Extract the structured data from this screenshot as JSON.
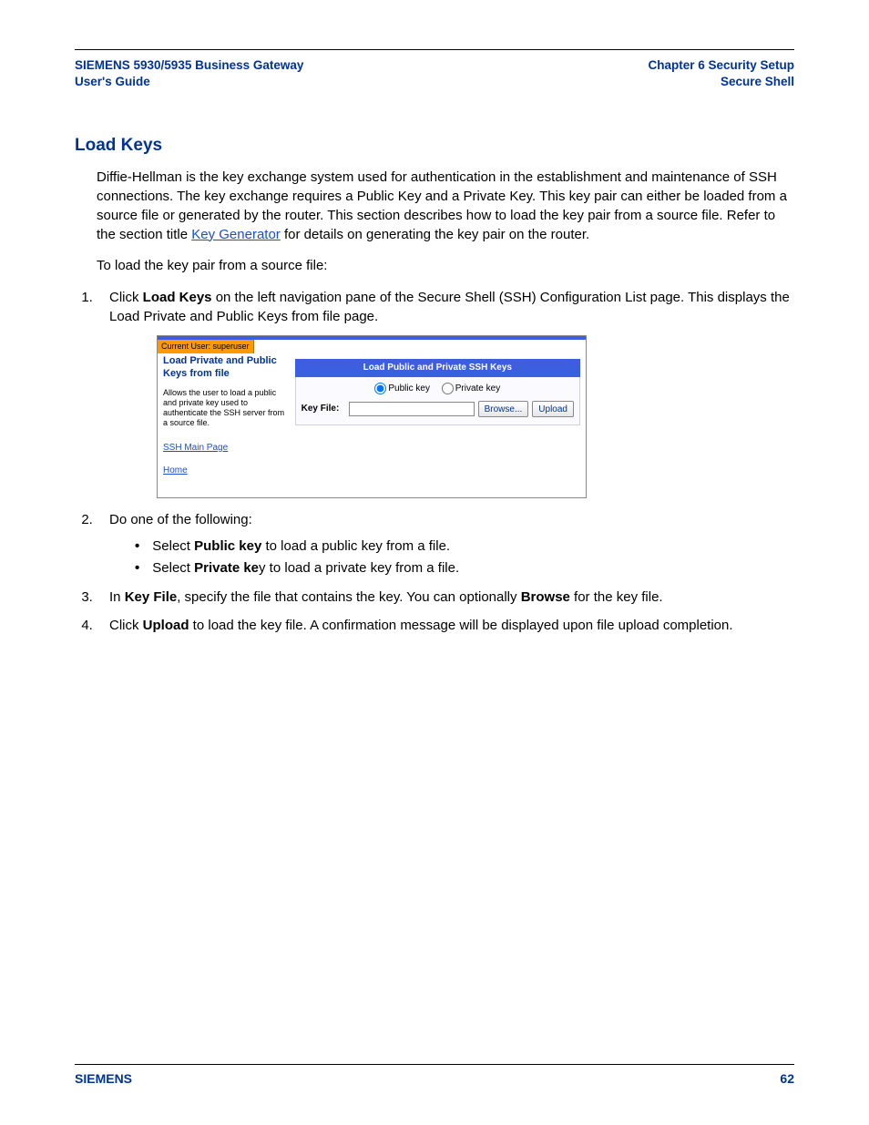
{
  "header": {
    "left_line1": "SIEMENS 5930/5935 Business Gateway",
    "left_line2": "User's Guide",
    "right_line1": "Chapter 6  Security Setup",
    "right_line2": "Secure Shell"
  },
  "section_title": "Load Keys",
  "intro_p1_pre": "Diffie-Hellman is the key exchange system used for authentication in the establishment and maintenance of SSH connections. The key exchange requires a Public Key and a Private Key. This key pair can either be loaded from a source file or generated by the router. This section describes how to load the key pair from a source file. Refer to the section title ",
  "intro_p1_link": "Key Generator",
  "intro_p1_post": " for details on generating the key pair on the router.",
  "intro_p2": "To load the key pair from a source file:",
  "step1_pre": "Click ",
  "step1_bold": "Load Keys",
  "step1_post": " on the left navigation pane of the Secure Shell (SSH) Configuration List page. This displays the Load Private and Public Keys from file page.",
  "shot": {
    "current_user": "Current User: superuser",
    "left_title": "Load Private and Public Keys from file",
    "left_desc": "Allows the user to load a public and private key used to authenticate the SSH server from a source file.",
    "link_ssh": "SSH Main Page",
    "link_home": "Home",
    "panel_title": "Load Public and Private SSH Keys",
    "radio_public": "Public key",
    "radio_private": "Private key",
    "file_label": "Key File:",
    "browse": "Browse...",
    "upload": "Upload"
  },
  "step2_intro": "Do one of the following:",
  "step2a_pre": "Select ",
  "step2a_bold": "Public key",
  "step2a_post": " to load a public key from a file.",
  "step2b_pre": "Select ",
  "step2b_bold": "Private ke",
  "step2b_post": "y to load a private key from a file.",
  "step3_pre": "In ",
  "step3_bold1": "Key File",
  "step3_mid": ", specify the file that contains the key. You can optionally ",
  "step3_bold2": "Browse",
  "step3_post": " for the key file.",
  "step4_pre": "Click ",
  "step4_bold": "Upload",
  "step4_post": " to load the key file. A confirmation message will be displayed upon file upload completion.",
  "footer": {
    "brand": "SIEMENS",
    "page": "62"
  }
}
